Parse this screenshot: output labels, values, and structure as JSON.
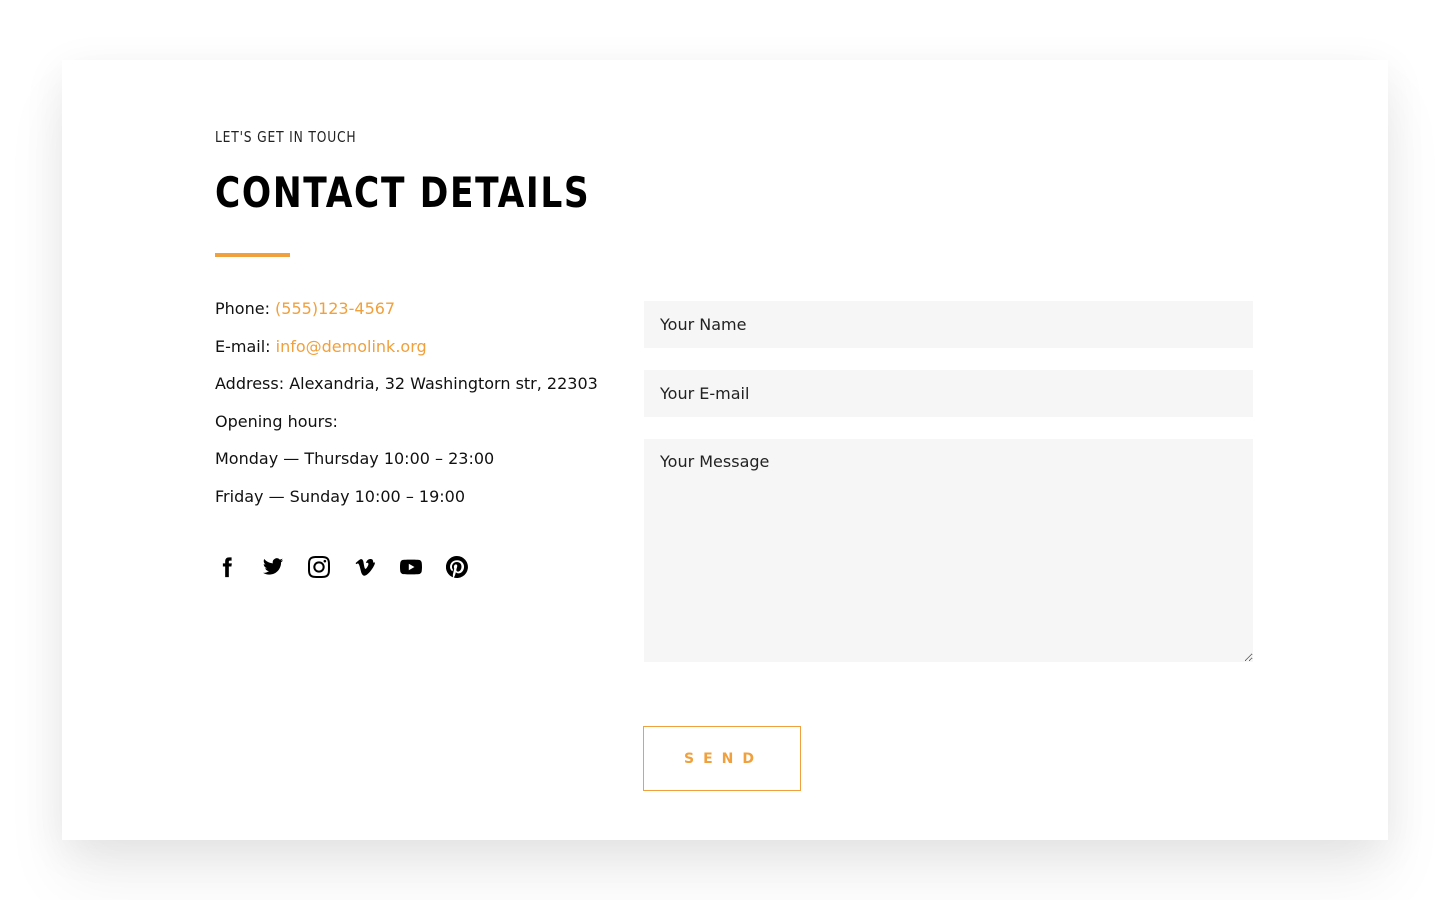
{
  "section": {
    "eyebrow": "LET'S GET IN TOUCH",
    "title": "CONTACT DETAILS"
  },
  "contact": {
    "phone_label": "Phone: ",
    "phone_value": "(555)123-4567",
    "email_label": "E-mail: ",
    "email_value": "info@demolink.org",
    "address": "Address: Alexandria, 32 Washingtorn str, 22303",
    "hours_label": "Opening hours:",
    "hours_weekdays": "Monday — Thursday 10:00 – 23:00",
    "hours_weekend": "Friday — Sunday 10:00 – 19:00"
  },
  "socials": [
    "facebook-icon",
    "twitter-icon",
    "instagram-icon",
    "vimeo-icon",
    "youtube-icon",
    "pinterest-icon"
  ],
  "form": {
    "name_placeholder": "Your Name",
    "email_placeholder": "Your E-mail",
    "message_placeholder": "Your Message",
    "send_label": "SEND"
  },
  "colors": {
    "accent": "#f0a03c",
    "field_bg": "#f6f6f6",
    "text": "#111111"
  }
}
